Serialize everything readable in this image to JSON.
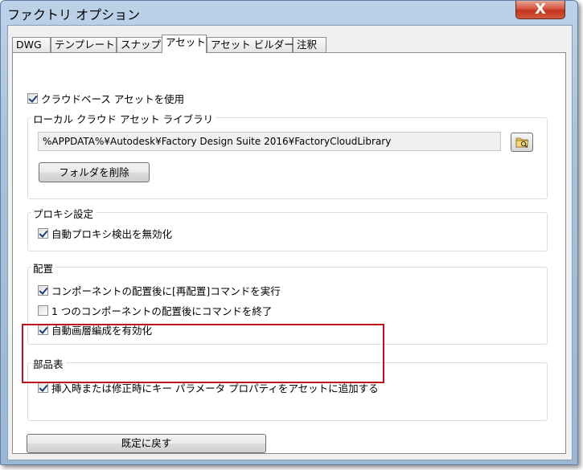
{
  "window": {
    "title": "ファクトリ オプション",
    "close_symbol": "X"
  },
  "tabs": [
    {
      "label": "DWG"
    },
    {
      "label": "テンプレート"
    },
    {
      "label": "スナップ"
    },
    {
      "label": "アセット"
    },
    {
      "label": "アセット ビルダー"
    },
    {
      "label": "注釈"
    }
  ],
  "active_tab": "アセット",
  "use_cloud": {
    "label": "クラウドベース アセットを使用",
    "checked": true
  },
  "local_library": {
    "title": "ローカル クラウド アセット ライブラリ",
    "path": "%APPDATA%¥Autodesk¥Factory Design Suite 2016¥FactoryCloudLibrary",
    "delete_button": "フォルダを削除",
    "browse_icon": "folder-icon"
  },
  "proxy": {
    "title": "プロキシ設定",
    "disable_auto": {
      "label": "自動プロキシ検出を無効化",
      "checked": true
    }
  },
  "placement": {
    "title": "配置",
    "options": [
      {
        "label": "コンポーネントの配置後に[再配置]コマンドを実行",
        "checked": true
      },
      {
        "label": "1 つのコンポーネントの配置後にコマンドを終了",
        "checked": false
      },
      {
        "label": "自動画層編成を有効化",
        "checked": true
      }
    ]
  },
  "bom": {
    "title": "部品表",
    "add_props": {
      "label": "挿入時または修正時にキー パラメータ プロパティをアセットに追加する",
      "checked": true
    }
  },
  "reset_button": "既定に戻す",
  "colors": {
    "highlight": "#c0101a",
    "titlebar": "#a9c2dc"
  }
}
